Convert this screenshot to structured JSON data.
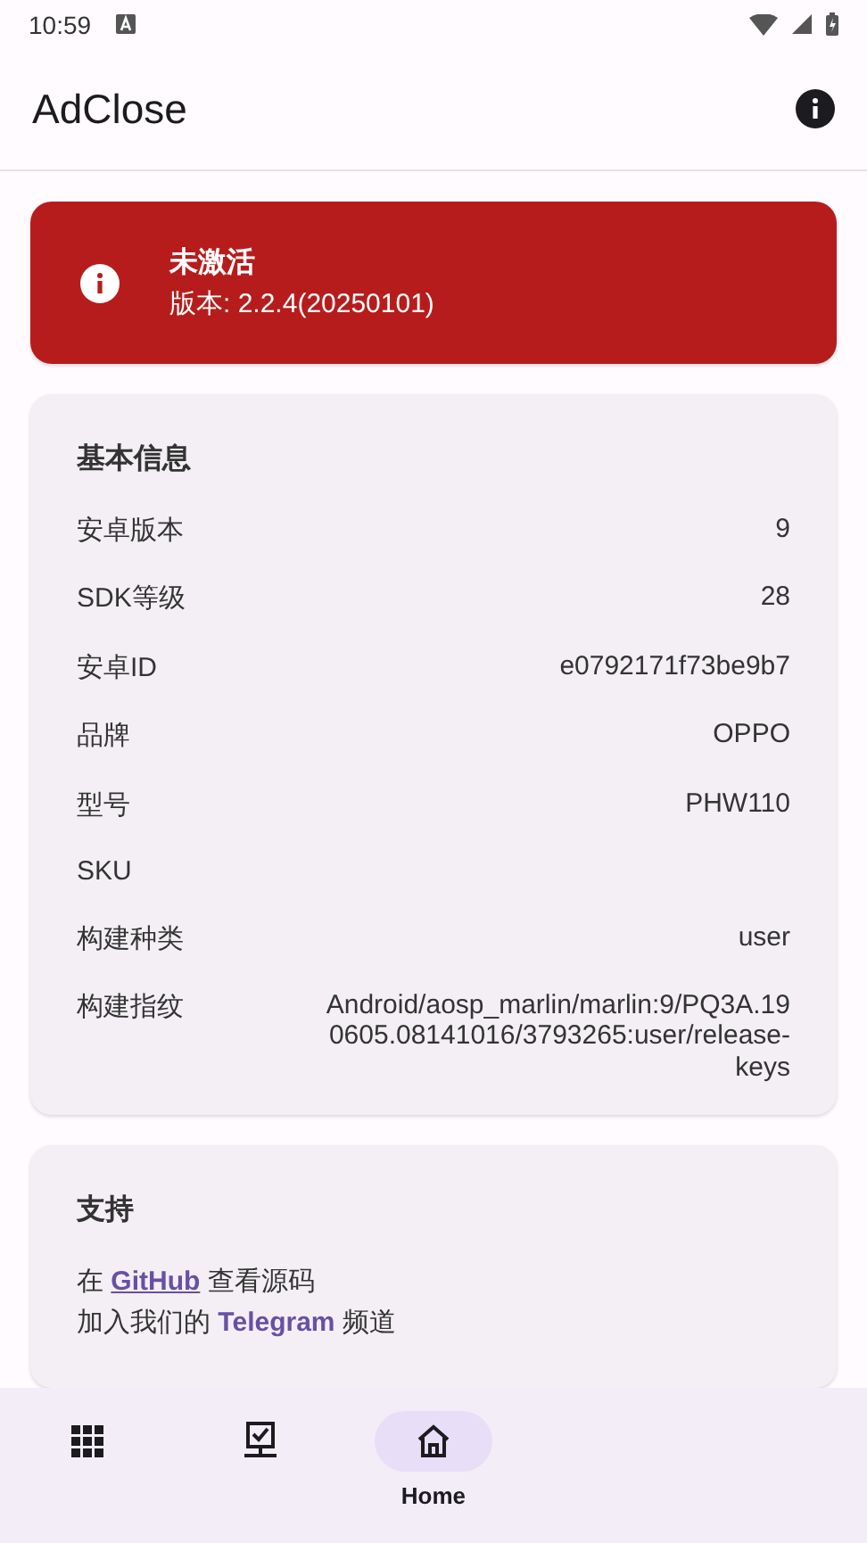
{
  "status_bar": {
    "time": "10:59"
  },
  "app_bar": {
    "title": "AdClose"
  },
  "status_card": {
    "title": "未激活",
    "version": "版本: 2.2.4(20250101)",
    "activated": false
  },
  "info_card": {
    "title": "基本信息",
    "rows": [
      {
        "label": "安卓版本",
        "value": "9"
      },
      {
        "label": "SDK等级",
        "value": "28"
      },
      {
        "label": "安卓ID",
        "value": "e0792171f73be9b7"
      },
      {
        "label": "品牌",
        "value": "OPPO"
      },
      {
        "label": "型号",
        "value": "PHW110"
      },
      {
        "label": "SKU"
      },
      {
        "label": "构建种类",
        "value": "user"
      },
      {
        "label": "构建指纹",
        "value": "Android/aosp_marlin/marlin:9/PQ3A.190605.08141016/3793265:user/release-keys"
      }
    ]
  },
  "support_card": {
    "title": "支持",
    "lines": [
      {
        "before": "在 ",
        "link": "GitHub",
        "after": " 查看源码"
      },
      {
        "before": "加入我们的 ",
        "link": "Telegram",
        "after": " 频道"
      }
    ]
  },
  "bottom_nav": [
    {
      "kind": "apps",
      "selected": false
    },
    {
      "kind": "modules",
      "selected": false
    },
    {
      "kind": "home",
      "label": "Home",
      "selected": true
    }
  ]
}
